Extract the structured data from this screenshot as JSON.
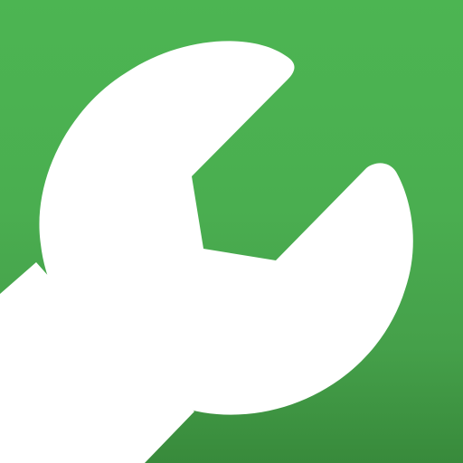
{
  "icon": {
    "name": "wrench-icon",
    "background_top": "#4cb552",
    "background_bottom": "#388a3b",
    "glyph_color": "#ffffff"
  }
}
